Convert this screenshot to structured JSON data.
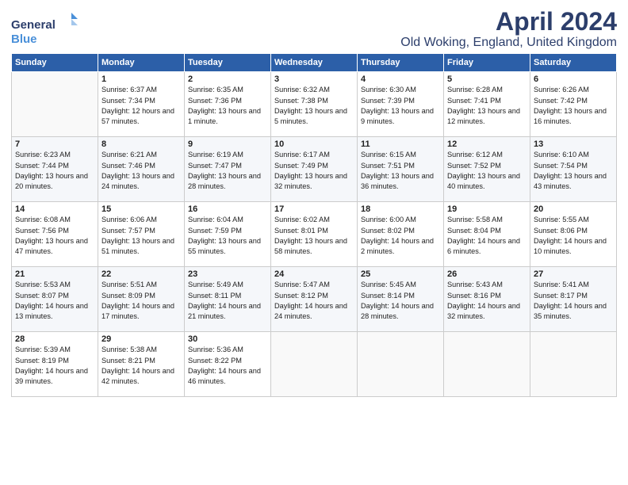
{
  "header": {
    "logo_general": "General",
    "logo_blue": "Blue",
    "month_title": "April 2024",
    "location": "Old Woking, England, United Kingdom"
  },
  "columns": [
    "Sunday",
    "Monday",
    "Tuesday",
    "Wednesday",
    "Thursday",
    "Friday",
    "Saturday"
  ],
  "weeks": [
    [
      {
        "day": "",
        "empty": true
      },
      {
        "day": "1",
        "sunrise": "Sunrise: 6:37 AM",
        "sunset": "Sunset: 7:34 PM",
        "daylight": "Daylight: 12 hours and 57 minutes."
      },
      {
        "day": "2",
        "sunrise": "Sunrise: 6:35 AM",
        "sunset": "Sunset: 7:36 PM",
        "daylight": "Daylight: 13 hours and 1 minute."
      },
      {
        "day": "3",
        "sunrise": "Sunrise: 6:32 AM",
        "sunset": "Sunset: 7:38 PM",
        "daylight": "Daylight: 13 hours and 5 minutes."
      },
      {
        "day": "4",
        "sunrise": "Sunrise: 6:30 AM",
        "sunset": "Sunset: 7:39 PM",
        "daylight": "Daylight: 13 hours and 9 minutes."
      },
      {
        "day": "5",
        "sunrise": "Sunrise: 6:28 AM",
        "sunset": "Sunset: 7:41 PM",
        "daylight": "Daylight: 13 hours and 12 minutes."
      },
      {
        "day": "6",
        "sunrise": "Sunrise: 6:26 AM",
        "sunset": "Sunset: 7:42 PM",
        "daylight": "Daylight: 13 hours and 16 minutes."
      }
    ],
    [
      {
        "day": "7",
        "sunrise": "Sunrise: 6:23 AM",
        "sunset": "Sunset: 7:44 PM",
        "daylight": "Daylight: 13 hours and 20 minutes."
      },
      {
        "day": "8",
        "sunrise": "Sunrise: 6:21 AM",
        "sunset": "Sunset: 7:46 PM",
        "daylight": "Daylight: 13 hours and 24 minutes."
      },
      {
        "day": "9",
        "sunrise": "Sunrise: 6:19 AM",
        "sunset": "Sunset: 7:47 PM",
        "daylight": "Daylight: 13 hours and 28 minutes."
      },
      {
        "day": "10",
        "sunrise": "Sunrise: 6:17 AM",
        "sunset": "Sunset: 7:49 PM",
        "daylight": "Daylight: 13 hours and 32 minutes."
      },
      {
        "day": "11",
        "sunrise": "Sunrise: 6:15 AM",
        "sunset": "Sunset: 7:51 PM",
        "daylight": "Daylight: 13 hours and 36 minutes."
      },
      {
        "day": "12",
        "sunrise": "Sunrise: 6:12 AM",
        "sunset": "Sunset: 7:52 PM",
        "daylight": "Daylight: 13 hours and 40 minutes."
      },
      {
        "day": "13",
        "sunrise": "Sunrise: 6:10 AM",
        "sunset": "Sunset: 7:54 PM",
        "daylight": "Daylight: 13 hours and 43 minutes."
      }
    ],
    [
      {
        "day": "14",
        "sunrise": "Sunrise: 6:08 AM",
        "sunset": "Sunset: 7:56 PM",
        "daylight": "Daylight: 13 hours and 47 minutes."
      },
      {
        "day": "15",
        "sunrise": "Sunrise: 6:06 AM",
        "sunset": "Sunset: 7:57 PM",
        "daylight": "Daylight: 13 hours and 51 minutes."
      },
      {
        "day": "16",
        "sunrise": "Sunrise: 6:04 AM",
        "sunset": "Sunset: 7:59 PM",
        "daylight": "Daylight: 13 hours and 55 minutes."
      },
      {
        "day": "17",
        "sunrise": "Sunrise: 6:02 AM",
        "sunset": "Sunset: 8:01 PM",
        "daylight": "Daylight: 13 hours and 58 minutes."
      },
      {
        "day": "18",
        "sunrise": "Sunrise: 6:00 AM",
        "sunset": "Sunset: 8:02 PM",
        "daylight": "Daylight: 14 hours and 2 minutes."
      },
      {
        "day": "19",
        "sunrise": "Sunrise: 5:58 AM",
        "sunset": "Sunset: 8:04 PM",
        "daylight": "Daylight: 14 hours and 6 minutes."
      },
      {
        "day": "20",
        "sunrise": "Sunrise: 5:55 AM",
        "sunset": "Sunset: 8:06 PM",
        "daylight": "Daylight: 14 hours and 10 minutes."
      }
    ],
    [
      {
        "day": "21",
        "sunrise": "Sunrise: 5:53 AM",
        "sunset": "Sunset: 8:07 PM",
        "daylight": "Daylight: 14 hours and 13 minutes."
      },
      {
        "day": "22",
        "sunrise": "Sunrise: 5:51 AM",
        "sunset": "Sunset: 8:09 PM",
        "daylight": "Daylight: 14 hours and 17 minutes."
      },
      {
        "day": "23",
        "sunrise": "Sunrise: 5:49 AM",
        "sunset": "Sunset: 8:11 PM",
        "daylight": "Daylight: 14 hours and 21 minutes."
      },
      {
        "day": "24",
        "sunrise": "Sunrise: 5:47 AM",
        "sunset": "Sunset: 8:12 PM",
        "daylight": "Daylight: 14 hours and 24 minutes."
      },
      {
        "day": "25",
        "sunrise": "Sunrise: 5:45 AM",
        "sunset": "Sunset: 8:14 PM",
        "daylight": "Daylight: 14 hours and 28 minutes."
      },
      {
        "day": "26",
        "sunrise": "Sunrise: 5:43 AM",
        "sunset": "Sunset: 8:16 PM",
        "daylight": "Daylight: 14 hours and 32 minutes."
      },
      {
        "day": "27",
        "sunrise": "Sunrise: 5:41 AM",
        "sunset": "Sunset: 8:17 PM",
        "daylight": "Daylight: 14 hours and 35 minutes."
      }
    ],
    [
      {
        "day": "28",
        "sunrise": "Sunrise: 5:39 AM",
        "sunset": "Sunset: 8:19 PM",
        "daylight": "Daylight: 14 hours and 39 minutes."
      },
      {
        "day": "29",
        "sunrise": "Sunrise: 5:38 AM",
        "sunset": "Sunset: 8:21 PM",
        "daylight": "Daylight: 14 hours and 42 minutes."
      },
      {
        "day": "30",
        "sunrise": "Sunrise: 5:36 AM",
        "sunset": "Sunset: 8:22 PM",
        "daylight": "Daylight: 14 hours and 46 minutes."
      },
      {
        "day": "",
        "empty": true
      },
      {
        "day": "",
        "empty": true
      },
      {
        "day": "",
        "empty": true
      },
      {
        "day": "",
        "empty": true
      }
    ]
  ]
}
